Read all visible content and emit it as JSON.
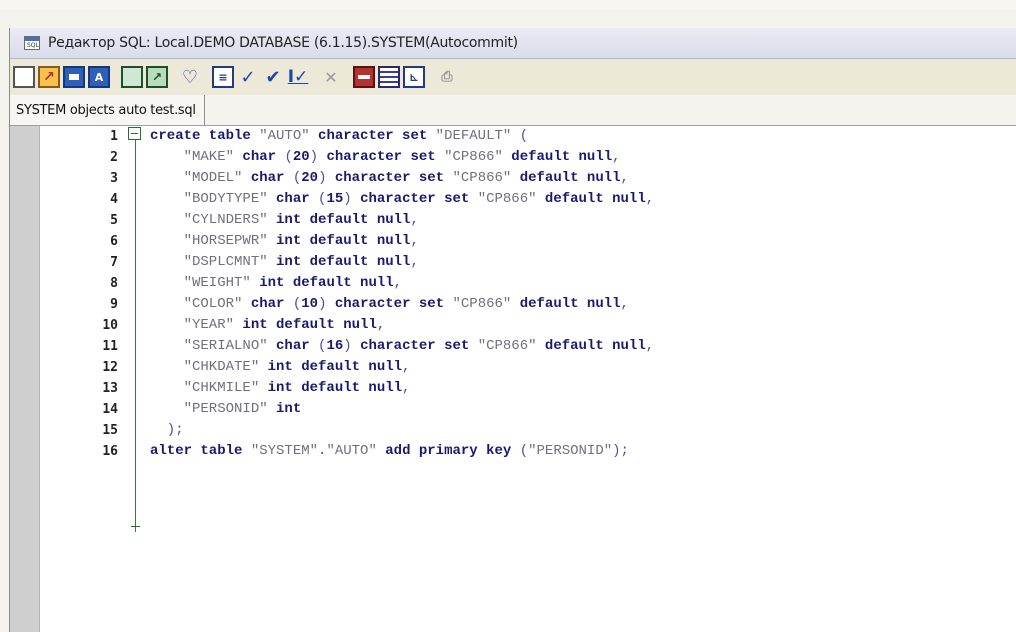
{
  "window": {
    "title": "Редактор SQL: Local.DEMO DATABASE (6.1.15).SYSTEM(Autocommit)",
    "icon_text": "SQL"
  },
  "toolbar": {
    "icons": [
      "new-file-icon",
      "open-file-icon",
      "save-icon",
      "save-as-icon",
      "grid-icon",
      "export-icon",
      "heart-icon",
      "list-icon",
      "check-icon",
      "commit-icon",
      "commit-step-icon",
      "close-icon",
      "stop-icon",
      "table-icon",
      "chart-icon",
      "print-icon"
    ]
  },
  "tab": {
    "label": "SYSTEM objects auto test.sql"
  },
  "editor": {
    "lines": [
      {
        "num": "1",
        "code": [
          [
            "kw",
            "create table "
          ],
          [
            "str",
            "\"AUTO\""
          ],
          [
            "kw",
            " character set "
          ],
          [
            "str",
            "\"DEFAULT\""
          ],
          [
            "pun",
            " ("
          ]
        ]
      },
      {
        "num": "2",
        "code": [
          [
            "str",
            "    \"MAKE\""
          ],
          [
            "kw",
            " char "
          ],
          [
            "pun",
            "("
          ],
          [
            "kw",
            "20"
          ],
          [
            "pun",
            ")"
          ],
          [
            "kw",
            " character set "
          ],
          [
            "str",
            "\"CP866\""
          ],
          [
            "kw",
            " default null"
          ],
          [
            "pun",
            ","
          ]
        ]
      },
      {
        "num": "3",
        "code": [
          [
            "str",
            "    \"MODEL\""
          ],
          [
            "kw",
            " char "
          ],
          [
            "pun",
            "("
          ],
          [
            "kw",
            "20"
          ],
          [
            "pun",
            ")"
          ],
          [
            "kw",
            " character set "
          ],
          [
            "str",
            "\"CP866\""
          ],
          [
            "kw",
            " default null"
          ],
          [
            "pun",
            ","
          ]
        ]
      },
      {
        "num": "4",
        "code": [
          [
            "str",
            "    \"BODYTYPE\""
          ],
          [
            "kw",
            " char "
          ],
          [
            "pun",
            "("
          ],
          [
            "kw",
            "15"
          ],
          [
            "pun",
            ")"
          ],
          [
            "kw",
            " character set "
          ],
          [
            "str",
            "\"CP866\""
          ],
          [
            "kw",
            " default null"
          ],
          [
            "pun",
            ","
          ]
        ]
      },
      {
        "num": "5",
        "code": [
          [
            "str",
            "    \"CYLNDERS\""
          ],
          [
            "kw",
            " int default null"
          ],
          [
            "pun",
            ","
          ]
        ]
      },
      {
        "num": "6",
        "code": [
          [
            "str",
            "    \"HORSEPWR\""
          ],
          [
            "kw",
            " int default null"
          ],
          [
            "pun",
            ","
          ]
        ]
      },
      {
        "num": "7",
        "code": [
          [
            "str",
            "    \"DSPLCMNT\""
          ],
          [
            "kw",
            " int default null"
          ],
          [
            "pun",
            ","
          ]
        ]
      },
      {
        "num": "8",
        "code": [
          [
            "str",
            "    \"WEIGHT\""
          ],
          [
            "kw",
            " int default null"
          ],
          [
            "pun",
            ","
          ]
        ]
      },
      {
        "num": "9",
        "code": [
          [
            "str",
            "    \"COLOR\""
          ],
          [
            "kw",
            " char "
          ],
          [
            "pun",
            "("
          ],
          [
            "kw",
            "10"
          ],
          [
            "pun",
            ")"
          ],
          [
            "kw",
            " character set "
          ],
          [
            "str",
            "\"CP866\""
          ],
          [
            "kw",
            " default null"
          ],
          [
            "pun",
            ","
          ]
        ]
      },
      {
        "num": "10",
        "code": [
          [
            "str",
            "    \"YEAR\""
          ],
          [
            "kw",
            " int default null"
          ],
          [
            "pun",
            ","
          ]
        ]
      },
      {
        "num": "11",
        "code": [
          [
            "str",
            "    \"SERIALNO\""
          ],
          [
            "kw",
            " char "
          ],
          [
            "pun",
            "("
          ],
          [
            "kw",
            "16"
          ],
          [
            "pun",
            ")"
          ],
          [
            "kw",
            " character set "
          ],
          [
            "str",
            "\"CP866\""
          ],
          [
            "kw",
            " default null"
          ],
          [
            "pun",
            ","
          ]
        ]
      },
      {
        "num": "12",
        "code": [
          [
            "str",
            "    \"CHKDATE\""
          ],
          [
            "kw",
            " int default null"
          ],
          [
            "pun",
            ","
          ]
        ]
      },
      {
        "num": "13",
        "code": [
          [
            "str",
            "    \"CHKMILE\""
          ],
          [
            "kw",
            " int default null"
          ],
          [
            "pun",
            ","
          ]
        ]
      },
      {
        "num": "14",
        "code": [
          [
            "str",
            "    \"PERSONID\""
          ],
          [
            "kw",
            " int"
          ]
        ]
      },
      {
        "num": "15",
        "code": [
          [
            "pun",
            "  );"
          ]
        ]
      },
      {
        "num": "16",
        "code": [
          [
            "kw",
            "alter table "
          ],
          [
            "str",
            "\"SYSTEM\""
          ],
          [
            "pun",
            "."
          ],
          [
            "str",
            "\"AUTO\""
          ],
          [
            "kw",
            " add primary key "
          ],
          [
            "pun",
            "("
          ],
          [
            "str",
            "\"PERSONID\""
          ],
          [
            "pun",
            ");"
          ]
        ]
      }
    ]
  },
  "colors": {
    "keyword": "#1a1a6e",
    "string": "#6f6f7f",
    "punctuation": "#4c4c9c",
    "fold_marker": "#2e6b2e"
  }
}
